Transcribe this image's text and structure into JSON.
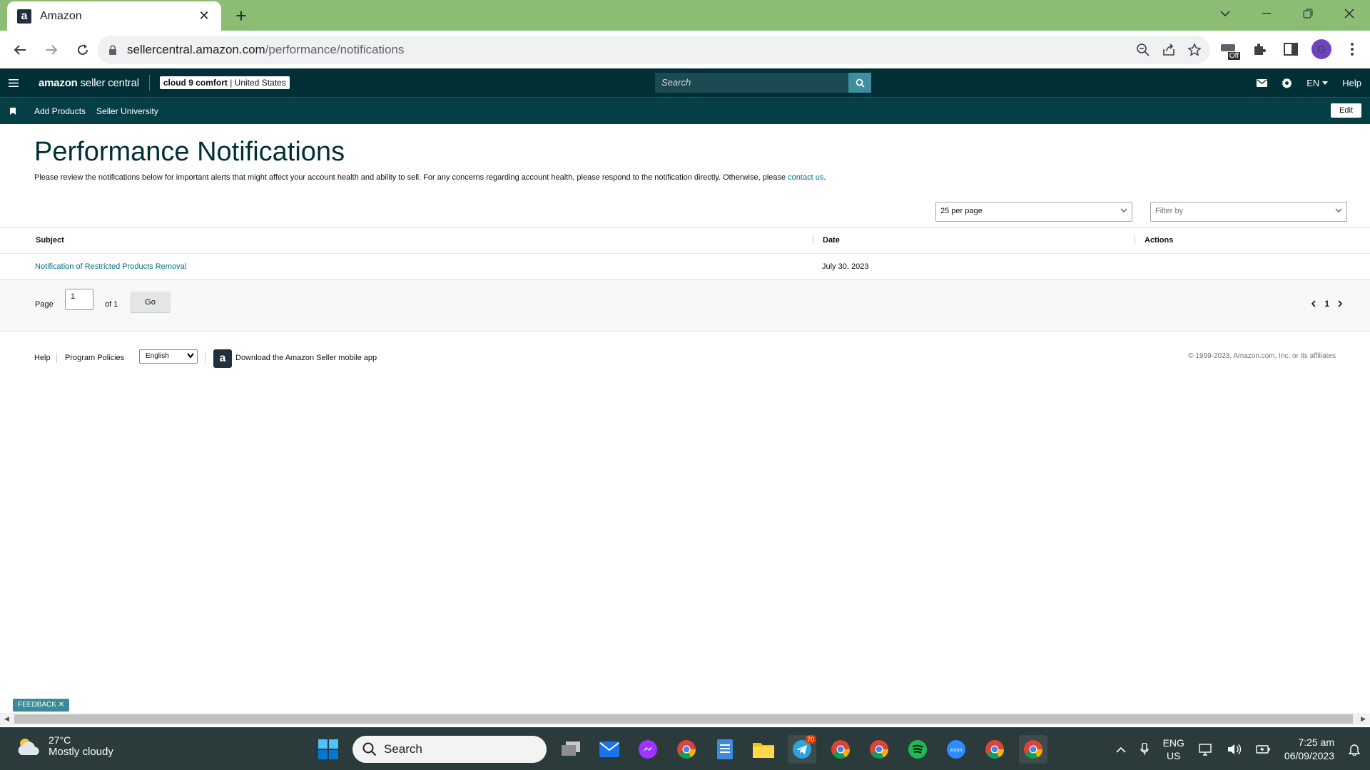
{
  "browser": {
    "tab_title": "Amazon",
    "favicon_letter": "a",
    "url_host": "sellercentral.amazon.com",
    "url_path": "/performance/notifications",
    "extension_badge": "Off",
    "profile_initial": "G"
  },
  "header": {
    "logo_amazon": "amazon",
    "logo_suffix": " seller central",
    "store_name": "cloud 9 comfort",
    "store_separator": " | ",
    "store_region": "United States",
    "search_placeholder": "Search",
    "language": "EN",
    "help": "Help"
  },
  "subnav": {
    "items": [
      "Add Products",
      "Seller University"
    ],
    "edit": "Edit"
  },
  "page": {
    "title": "Performance Notifications",
    "description": "Please review the notifications below for important alerts that might affect your account health and ability to sell. For any concerns regarding account health, please respond to the notification directly. Otherwise, please ",
    "contact_link": "contact us",
    "description_end": ".",
    "per_page": "25 per page",
    "filter_placeholder": "Filter by"
  },
  "table": {
    "columns": [
      "Subject",
      "Date",
      "Actions"
    ],
    "rows": [
      {
        "subject": "Notification of Restricted Products Removal",
        "date": "July 30, 2023",
        "actions": ""
      }
    ]
  },
  "pager": {
    "page_label": "Page",
    "page_value": "1",
    "of_label": "of 1",
    "go": "Go",
    "current": "1"
  },
  "footer": {
    "help": "Help",
    "program_policies": "Program Policies",
    "language": "English",
    "app_link": "Download the Amazon Seller mobile app",
    "copyright": "© 1999-2023, Amazon.com, Inc. or its affiliates"
  },
  "feedback": "FEEDBACK",
  "taskbar": {
    "temperature": "27°C",
    "condition": "Mostly cloudy",
    "search": "Search",
    "telegram_badge": "70",
    "lang_line1": "ENG",
    "lang_line2": "US",
    "time": "7:25 am",
    "date": "06/09/2023"
  },
  "colors": {
    "tabstrip": "#8bbd74",
    "header_bg": "#002f36",
    "subnav_bg": "#063e46",
    "link": "#007185",
    "title": "#002f36"
  }
}
